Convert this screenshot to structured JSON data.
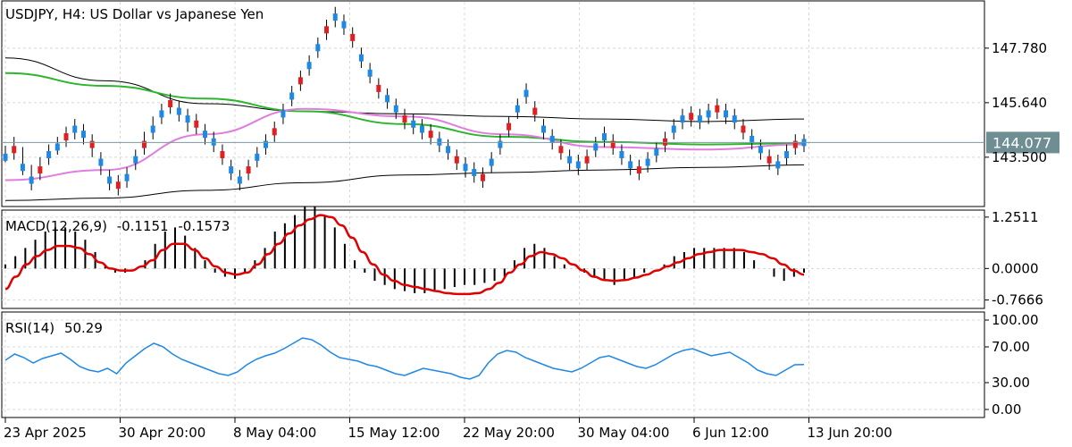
{
  "header": {
    "symbol": "USDJPY",
    "timeframe": "H4",
    "title_sep": ",",
    "description": "US Dollar vs Japanese Yen"
  },
  "chart_data": [
    {
      "type": "candlestick",
      "title": "USDJPY, H4:  US Dollar vs Japanese Yen",
      "y_ticks": [
        "147.780",
        "145.640",
        "143.500"
      ],
      "y_tick_values": [
        147.78,
        145.64,
        143.5
      ],
      "ylim": [
        141.6,
        149.6
      ],
      "current_price": "144.077",
      "current_price_value": 144.077,
      "x_labels": [
        "23 Apr 2025",
        "30 Apr 20:00",
        "8 May 04:00",
        "15 May 12:00",
        "22 May 20:00",
        "30 May 04:00",
        "6 Jun 12:00",
        "13 Jun 20:00"
      ],
      "overlays": [
        {
          "name": "SMA (green)",
          "color": "#2db52d"
        },
        {
          "name": "SMA (violet)",
          "color": "#e07ee0"
        },
        {
          "name": "Bollinger Bands",
          "color": "#000000"
        }
      ],
      "candles": [
        [
          143.5,
          143.95,
          143.3,
          143.5
        ],
        [
          143.8,
          144.3,
          143.4,
          143.8
        ],
        [
          143.1,
          143.9,
          142.8,
          143.1
        ],
        [
          142.6,
          143.2,
          142.2,
          142.6
        ],
        [
          143.0,
          143.5,
          142.6,
          143.0
        ],
        [
          143.6,
          144.0,
          143.2,
          143.6
        ],
        [
          143.9,
          144.3,
          143.6,
          143.9
        ],
        [
          144.3,
          144.7,
          143.9,
          144.3
        ],
        [
          144.6,
          145.0,
          144.2,
          144.6
        ],
        [
          144.4,
          144.8,
          144.0,
          144.4
        ],
        [
          144.0,
          144.4,
          143.5,
          144.0
        ],
        [
          143.3,
          143.7,
          142.8,
          143.3
        ],
        [
          142.6,
          143.0,
          142.2,
          142.6
        ],
        [
          142.4,
          142.8,
          142.0,
          142.4
        ],
        [
          142.7,
          143.1,
          142.3,
          142.7
        ],
        [
          143.4,
          143.8,
          143.0,
          143.4
        ],
        [
          144.0,
          144.5,
          143.6,
          144.0
        ],
        [
          144.6,
          145.1,
          144.2,
          144.6
        ],
        [
          145.2,
          145.6,
          144.8,
          145.2
        ],
        [
          145.6,
          146.0,
          145.2,
          145.6
        ],
        [
          145.3,
          145.7,
          144.9,
          145.3
        ],
        [
          145.0,
          145.4,
          144.5,
          145.0
        ],
        [
          144.8,
          145.2,
          144.4,
          144.8
        ],
        [
          144.4,
          144.8,
          144.0,
          144.4
        ],
        [
          144.1,
          144.5,
          143.7,
          144.1
        ],
        [
          143.6,
          144.0,
          143.2,
          143.6
        ],
        [
          143.0,
          143.4,
          142.6,
          143.0
        ],
        [
          142.6,
          143.0,
          142.2,
          142.6
        ],
        [
          143.0,
          143.4,
          142.6,
          143.0
        ],
        [
          143.5,
          143.9,
          143.1,
          143.5
        ],
        [
          144.0,
          144.4,
          143.6,
          144.0
        ],
        [
          144.5,
          144.9,
          144.1,
          144.5
        ],
        [
          145.2,
          145.6,
          144.8,
          145.2
        ],
        [
          145.9,
          146.3,
          145.5,
          145.9
        ],
        [
          146.5,
          146.9,
          146.1,
          146.5
        ],
        [
          147.1,
          147.5,
          146.7,
          147.1
        ],
        [
          147.8,
          148.2,
          147.4,
          147.8
        ],
        [
          148.5,
          148.9,
          148.1,
          148.5
        ],
        [
          149.0,
          149.4,
          148.6,
          149.0
        ],
        [
          148.7,
          149.1,
          148.3,
          148.7
        ],
        [
          148.2,
          148.6,
          147.8,
          148.2
        ],
        [
          147.4,
          147.8,
          147.0,
          147.4
        ],
        [
          146.8,
          147.2,
          146.4,
          146.8
        ],
        [
          146.2,
          146.6,
          145.8,
          146.2
        ],
        [
          145.8,
          146.2,
          145.4,
          145.8
        ],
        [
          145.4,
          145.8,
          145.0,
          145.4
        ],
        [
          145.0,
          145.4,
          144.6,
          145.0
        ],
        [
          144.8,
          145.2,
          144.4,
          144.8
        ],
        [
          144.6,
          145.0,
          144.2,
          144.6
        ],
        [
          144.4,
          144.8,
          144.0,
          144.4
        ],
        [
          144.1,
          144.5,
          143.7,
          144.1
        ],
        [
          143.8,
          144.2,
          143.4,
          143.8
        ],
        [
          143.4,
          143.8,
          143.0,
          143.4
        ],
        [
          143.1,
          143.5,
          142.7,
          143.1
        ],
        [
          142.9,
          143.3,
          142.5,
          142.9
        ],
        [
          142.7,
          143.1,
          142.3,
          142.7
        ],
        [
          143.3,
          143.7,
          142.9,
          143.3
        ],
        [
          144.0,
          144.4,
          143.6,
          144.0
        ],
        [
          144.7,
          145.1,
          144.3,
          144.7
        ],
        [
          145.4,
          145.8,
          145.0,
          145.4
        ],
        [
          146.0,
          146.4,
          145.6,
          146.0
        ],
        [
          145.3,
          145.7,
          144.9,
          145.3
        ],
        [
          144.6,
          145.0,
          144.2,
          144.6
        ],
        [
          144.2,
          144.6,
          143.8,
          144.2
        ],
        [
          143.8,
          144.2,
          143.4,
          143.8
        ],
        [
          143.4,
          143.8,
          143.0,
          143.4
        ],
        [
          143.2,
          143.6,
          142.8,
          143.2
        ],
        [
          143.4,
          143.8,
          143.0,
          143.4
        ],
        [
          143.9,
          144.3,
          143.5,
          143.9
        ],
        [
          144.3,
          144.7,
          143.9,
          144.3
        ],
        [
          144.0,
          144.4,
          143.6,
          144.0
        ],
        [
          143.6,
          144.0,
          143.2,
          143.6
        ],
        [
          143.2,
          143.6,
          142.8,
          143.2
        ],
        [
          143.0,
          143.4,
          142.6,
          143.0
        ],
        [
          143.3,
          143.7,
          142.9,
          143.3
        ],
        [
          143.7,
          144.1,
          143.3,
          143.7
        ],
        [
          144.1,
          144.5,
          143.7,
          144.1
        ],
        [
          144.6,
          145.0,
          144.2,
          144.6
        ],
        [
          145.0,
          145.4,
          144.6,
          145.0
        ],
        [
          145.1,
          145.5,
          144.7,
          145.1
        ],
        [
          145.0,
          145.4,
          144.6,
          145.0
        ],
        [
          145.2,
          145.6,
          144.8,
          145.2
        ],
        [
          145.4,
          145.8,
          145.0,
          145.4
        ],
        [
          145.2,
          145.6,
          144.8,
          145.2
        ],
        [
          145.0,
          145.4,
          144.6,
          145.0
        ],
        [
          144.6,
          145.0,
          144.2,
          144.6
        ],
        [
          144.2,
          144.6,
          143.8,
          144.2
        ],
        [
          143.8,
          144.2,
          143.4,
          143.8
        ],
        [
          143.4,
          143.8,
          143.0,
          143.4
        ],
        [
          143.2,
          143.6,
          142.8,
          143.2
        ],
        [
          143.6,
          144.0,
          143.2,
          143.6
        ],
        [
          144.0,
          144.4,
          143.6,
          144.0
        ],
        [
          144.077,
          144.4,
          143.7,
          144.077
        ]
      ],
      "bb_upper": [
        147.4,
        146.5,
        145.6,
        145.3,
        145.2,
        145.1,
        145.0,
        144.9,
        145.0
      ],
      "bb_lower": [
        141.8,
        141.9,
        142.2,
        142.5,
        142.8,
        142.9,
        143.0,
        143.1,
        143.2
      ],
      "ma_green": [
        146.8,
        146.3,
        145.8,
        145.3,
        144.8,
        144.3,
        144.1,
        144.0,
        144.05
      ],
      "ma_violet": [
        142.6,
        143.0,
        144.4,
        145.4,
        145.1,
        144.4,
        143.9,
        143.8,
        144.0
      ]
    },
    {
      "type": "histogram+line",
      "title": "MACD(12,26,9)",
      "value_main": "-0.1151",
      "value_signal": "-0.1573",
      "y_ticks": [
        "1.2511",
        "0.0000",
        "-0.7666"
      ],
      "y_tick_values": [
        1.2511,
        0.0,
        -0.7666
      ],
      "ylim": [
        -0.95,
        1.4
      ],
      "signal_color": "#e00000",
      "histogram": [
        0.1,
        0.3,
        0.5,
        0.7,
        0.9,
        1.0,
        1.0,
        0.9,
        0.7,
        0.4,
        0.1,
        -0.1,
        -0.1,
        0.0,
        0.2,
        0.6,
        0.9,
        1.0,
        0.8,
        0.5,
        0.2,
        -0.1,
        -0.2,
        -0.25,
        -0.1,
        0.2,
        0.5,
        0.9,
        1.1,
        1.3,
        1.5,
        1.5,
        1.3,
        1.0,
        0.6,
        0.2,
        -0.1,
        -0.3,
        -0.4,
        -0.5,
        -0.55,
        -0.6,
        -0.6,
        -0.55,
        -0.5,
        -0.45,
        -0.4,
        -0.4,
        -0.35,
        -0.3,
        -0.2,
        0.2,
        0.5,
        0.6,
        0.5,
        0.3,
        0.1,
        0.0,
        -0.1,
        -0.2,
        -0.3,
        -0.4,
        -0.3,
        -0.2,
        -0.1,
        0.0,
        0.1,
        0.3,
        0.4,
        0.5,
        0.5,
        0.5,
        0.5,
        0.5,
        0.4,
        0.2,
        0.0,
        -0.2,
        -0.3,
        -0.2,
        -0.1
      ],
      "signal": [
        -0.5,
        -0.2,
        0.1,
        0.3,
        0.45,
        0.55,
        0.55,
        0.5,
        0.35,
        0.15,
        0.0,
        -0.05,
        -0.05,
        0.05,
        0.2,
        0.45,
        0.6,
        0.6,
        0.45,
        0.25,
        0.05,
        -0.1,
        -0.15,
        -0.1,
        0.1,
        0.35,
        0.6,
        0.85,
        1.05,
        1.2,
        1.3,
        1.25,
        1.05,
        0.75,
        0.4,
        0.1,
        -0.15,
        -0.3,
        -0.4,
        -0.45,
        -0.5,
        -0.55,
        -0.6,
        -0.62,
        -0.62,
        -0.6,
        -0.5,
        -0.35,
        -0.1,
        0.1,
        0.3,
        0.4,
        0.35,
        0.25,
        0.1,
        -0.05,
        -0.2,
        -0.28,
        -0.3,
        -0.28,
        -0.22,
        -0.15,
        -0.05,
        0.05,
        0.15,
        0.25,
        0.35,
        0.4,
        0.45,
        0.45,
        0.45,
        0.4,
        0.35,
        0.25,
        0.1,
        -0.05,
        -0.15
      ]
    },
    {
      "type": "line",
      "title": "RSI(14)",
      "value": "50.29",
      "y_ticks": [
        "100.00",
        "70.00",
        "30.00",
        "0.00"
      ],
      "y_tick_values": [
        100,
        70,
        30,
        0
      ],
      "ylim": [
        -8,
        108
      ],
      "color": "#1e88e5",
      "values": [
        55,
        62,
        58,
        52,
        57,
        60,
        63,
        56,
        48,
        44,
        42,
        46,
        40,
        52,
        60,
        68,
        74,
        70,
        62,
        56,
        52,
        48,
        44,
        40,
        38,
        42,
        50,
        56,
        60,
        63,
        68,
        74,
        80,
        78,
        72,
        64,
        58,
        56,
        54,
        50,
        48,
        44,
        40,
        38,
        42,
        46,
        44,
        42,
        40,
        36,
        34,
        38,
        52,
        62,
        66,
        64,
        58,
        54,
        50,
        46,
        44,
        42,
        46,
        52,
        58,
        60,
        56,
        52,
        48,
        46,
        50,
        56,
        62,
        66,
        68,
        64,
        60,
        62,
        64,
        58,
        52,
        44,
        40,
        38,
        44,
        50,
        50.29
      ]
    }
  ]
}
